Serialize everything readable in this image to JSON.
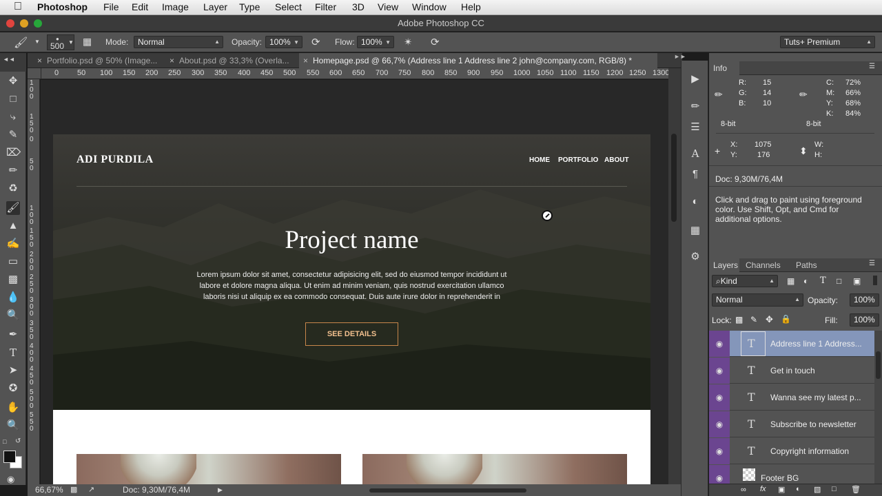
{
  "menubar": {
    "app": "Photoshop",
    "items": [
      "File",
      "Edit",
      "Image",
      "Layer",
      "Type",
      "Select",
      "Filter",
      "3D",
      "View",
      "Window",
      "Help"
    ]
  },
  "window": {
    "title": "Adobe Photoshop CC"
  },
  "options": {
    "brush_size": "500",
    "mode_label": "Mode:",
    "mode_value": "Normal",
    "opacity_label": "Opacity:",
    "opacity_value": "100%",
    "flow_label": "Flow:",
    "flow_value": "100%",
    "workspace": "Tuts+ Premium"
  },
  "tabs": [
    {
      "label": "Portfolio.psd @ 50% (Image..."
    },
    {
      "label": "About.psd @ 33,3% (Overla..."
    },
    {
      "label": "Homepage.psd @ 66,7% (Address line 1 Address line 2  john@company.com, RGB/8) *"
    }
  ],
  "ruler": {
    "top": [
      "0",
      "50",
      "100",
      "150",
      "200",
      "250",
      "300",
      "350",
      "400",
      "450",
      "500",
      "550",
      "600",
      "650",
      "700",
      "750",
      "800",
      "850",
      "900",
      "950",
      "1000",
      "1050",
      "1100",
      "1150",
      "1200",
      "1250",
      "1300"
    ],
    "left": [
      "0",
      "1\n0\n0",
      "1\n5\n0",
      "0",
      "5\n0",
      "1\n0\n0",
      "1\n5\n0",
      "2\n0\n0",
      "2\n5\n0",
      "3\n0\n0",
      "3\n5\n0",
      "4\n0\n0",
      "4\n5\n0",
      "5\n0\n0",
      "5\n5\n0"
    ]
  },
  "design": {
    "logo": "ADI PURDILA",
    "nav": [
      "HOME",
      "PORTFOLIO",
      "ABOUT"
    ],
    "heading": "Project name",
    "body": [
      "Lorem ipsum dolor sit amet, consectetur adipisicing elit, sed do eiusmod tempor incididunt ut",
      "labore et dolore magna aliqua. Ut enim ad minim veniam, quis nostrud exercitation ullamco",
      "laboris nisi ut aliquip ex ea commodo consequat. Duis aute irure dolor in reprehenderit in"
    ],
    "button": "SEE DETAILS"
  },
  "status": {
    "zoom": "66,67%",
    "doc": "Doc: 9,30M/76,4M"
  },
  "info": {
    "tab": "Info",
    "r_label": "R:",
    "r": "15",
    "g_label": "G:",
    "g": "14",
    "b_label": "B:",
    "b": "10",
    "c_label": "C:",
    "c": "72%",
    "m_label": "M:",
    "m": "66%",
    "y_label": "Y:",
    "y": "68%",
    "k_label": "K:",
    "k": "84%",
    "bit_left": "8-bit",
    "bit_right": "8-bit",
    "x_label": "X:",
    "x": "1075",
    "yy_label": "Y:",
    "yy": "176",
    "w_label": "W:",
    "h_label": "H:",
    "doc": "Doc: 9,30M/76,4M",
    "hint": [
      "Click and drag to paint using foreground",
      "color.  Use Shift, Opt, and Cmd for",
      "additional options."
    ]
  },
  "layers": {
    "tabs": [
      "Layers",
      "Channels",
      "Paths"
    ],
    "filter": "Kind",
    "blend": "Normal",
    "opacity_label": "Opacity:",
    "opacity": "100%",
    "lock_label": "Lock:",
    "fill_label": "Fill:",
    "fill": "100%",
    "items": [
      {
        "name": "Address line 1 Address...",
        "type": "text"
      },
      {
        "name": "Get in touch",
        "type": "text"
      },
      {
        "name": "Wanna see my latest p...",
        "type": "text"
      },
      {
        "name": "Subscribe to newsletter",
        "type": "text"
      },
      {
        "name": "Copyright information",
        "type": "text"
      },
      {
        "name": "Footer BG",
        "type": "raster"
      }
    ]
  },
  "colors": {
    "accent": "#6b4590",
    "button_border": "#c8874b",
    "panel": "#535353"
  }
}
